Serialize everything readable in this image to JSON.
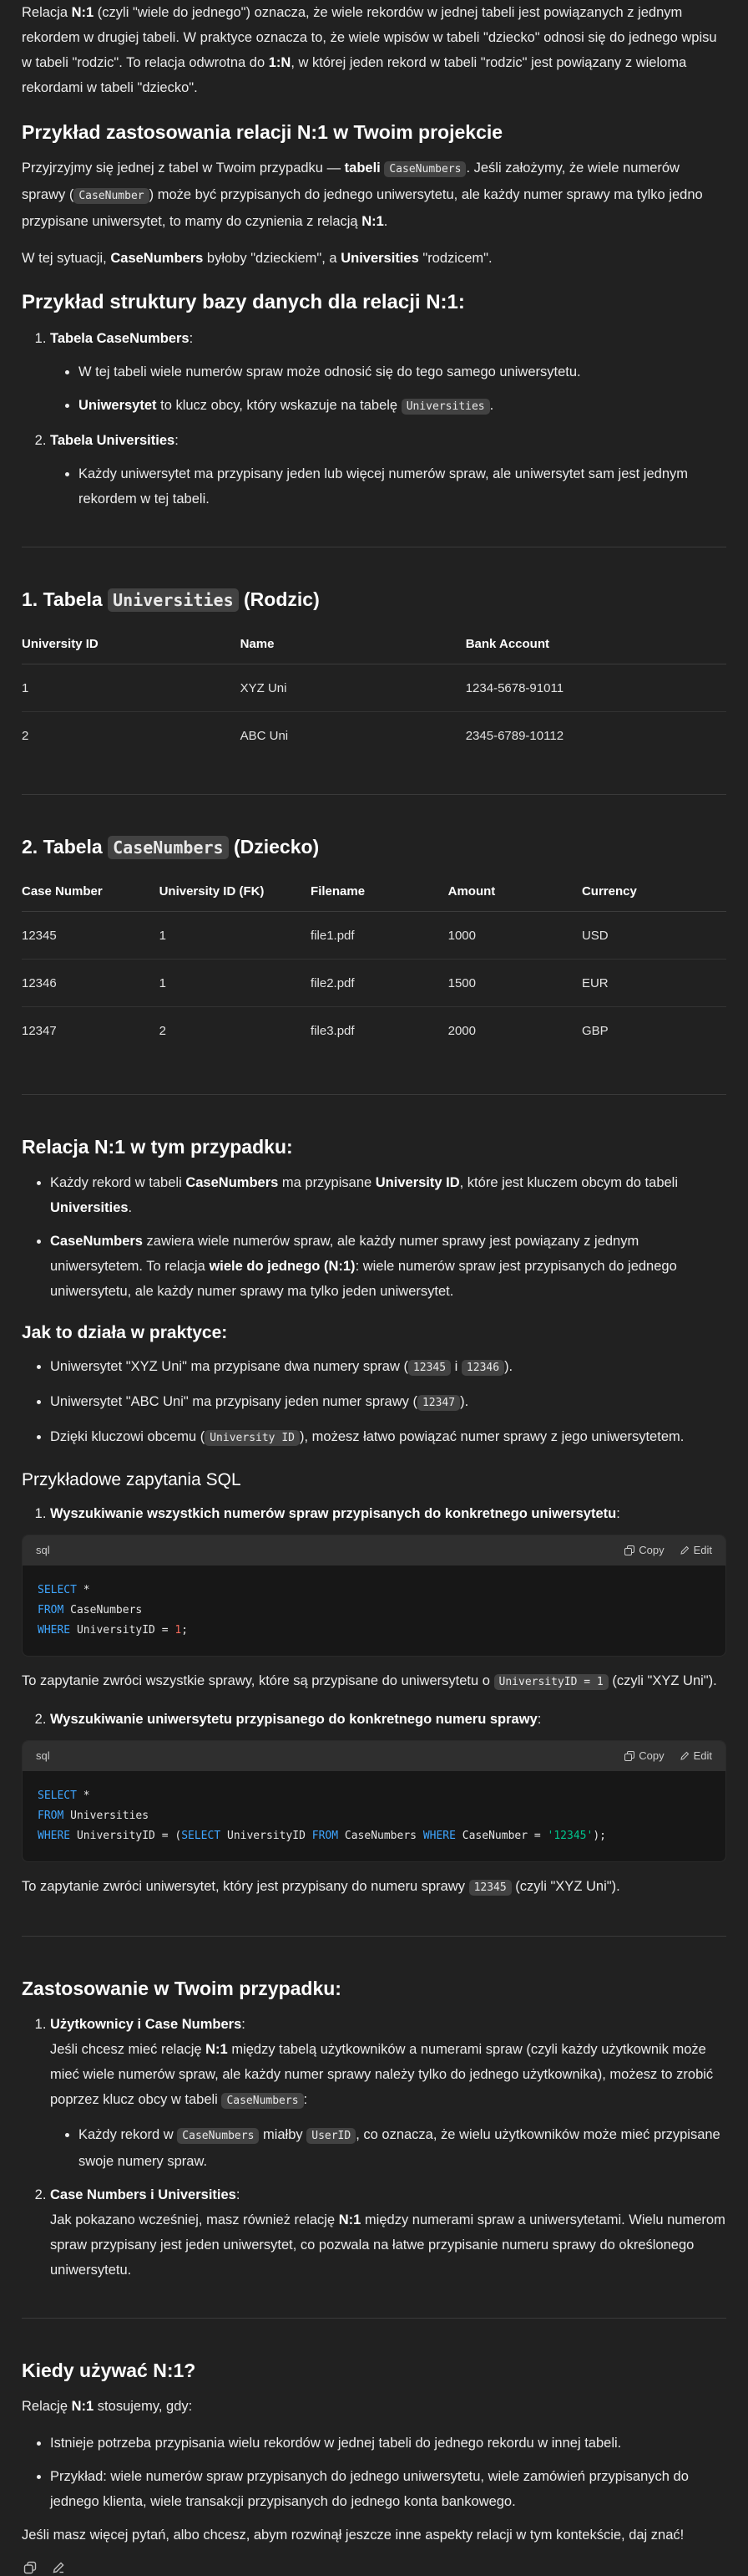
{
  "intro": {
    "p1_a": "Relacja ",
    "p1_b": "N:1",
    "p1_c": " (czyli \"wiele do jednego\") oznacza, że wiele rekordów w jednej tabeli jest powiązanych z jednym rekordem w drugiej tabeli. W praktyce oznacza to, że wiele wpisów w tabeli \"dziecko\" odnosi się do jednego wpisu w tabeli \"rodzic\". To relacja odwrotna do ",
    "p1_d": "1:N",
    "p1_e": ", w której jeden rekord w tabeli \"rodzic\" jest powiązany z wieloma rekordami w tabeli \"dziecko\"."
  },
  "example": {
    "heading": "Przykład zastosowania relacji N:1 w Twoim projekcie",
    "p1_a": "Przyjrzyjmy się jednej z tabel w Twoim przypadku — ",
    "p1_b": "tabeli",
    "p1_code": "CaseNumbers",
    "p1_c": ". Jeśli założymy, że wiele numerów sprawy (",
    "p1_code2": "CaseNumber",
    "p1_d": ") może być przypisanych do jednego uniwersytetu, ale każdy numer sprawy ma tylko jedno przypisane uniwersytet, to mamy do czynienia z relacją ",
    "p1_e": "N:1",
    "p1_f": ".",
    "p2_a": "W tej sytuacji, ",
    "p2_b": "CaseNumbers",
    "p2_c": " byłoby \"dzieckiem\", a ",
    "p2_d": "Universities",
    "p2_e": " \"rodzicem\"."
  },
  "structure": {
    "heading": "Przykład struktury bazy danych dla relacji N:1:",
    "item1_title": "Tabela CaseNumbers",
    "item1_colon": ":",
    "item1_b1": "W tej tabeli wiele numerów spraw może odnosić się do tego samego uniwersytetu.",
    "item1_b2_a": "Uniwersytet",
    "item1_b2_b": " to klucz obcy, który wskazuje na tabelę ",
    "item1_b2_code": "Universities",
    "item1_b2_c": ".",
    "item2_title": "Tabela Universities",
    "item2_colon": ":",
    "item2_b1": "Każdy uniwersytet ma przypisany jeden lub więcej numerów spraw, ale uniwersytet sam jest jednym rekordem w tej tabeli."
  },
  "table1": {
    "heading_a": "1. Tabela ",
    "heading_code": "Universities",
    "heading_b": " (Rodzic)",
    "headers": [
      "University ID",
      "Name",
      "Bank Account"
    ],
    "rows": [
      [
        "1",
        "XYZ Uni",
        "1234-5678-91011"
      ],
      [
        "2",
        "ABC Uni",
        "2345-6789-10112"
      ]
    ]
  },
  "table2": {
    "heading_a": "2. Tabela ",
    "heading_code": "CaseNumbers",
    "heading_b": " (Dziecko)",
    "headers": [
      "Case Number",
      "University ID (FK)",
      "Filename",
      "Amount",
      "Currency"
    ],
    "rows": [
      [
        "12345",
        "1",
        "file1.pdf",
        "1000",
        "USD"
      ],
      [
        "12346",
        "1",
        "file2.pdf",
        "1500",
        "EUR"
      ],
      [
        "12347",
        "2",
        "file3.pdf",
        "2000",
        "GBP"
      ]
    ]
  },
  "relation": {
    "heading": "Relacja N:1 w tym przypadku:",
    "b1_a": "Każdy rekord w tabeli ",
    "b1_b": "CaseNumbers",
    "b1_c": " ma przypisane ",
    "b1_d": "University ID",
    "b1_e": ", które jest kluczem obcym do tabeli ",
    "b1_f": "Universities",
    "b1_g": ".",
    "b2_a": "CaseNumbers",
    "b2_b": " zawiera wiele numerów spraw, ale każdy numer sprawy jest powiązany z jednym uniwersytetem. To relacja ",
    "b2_c": "wiele do jednego (N:1)",
    "b2_d": ": wiele numerów spraw jest przypisanych do jednego uniwersytetu, ale każdy numer sprawy ma tylko jeden uniwersytet."
  },
  "practice": {
    "heading": "Jak to działa w praktyce:",
    "b1_a": "Uniwersytet \"XYZ Uni\" ma przypisane dwa numery spraw (",
    "b1_code1": "12345",
    "b1_b": " i ",
    "b1_code2": "12346",
    "b1_c": ").",
    "b2_a": "Uniwersytet \"ABC Uni\" ma przypisany jeden numer sprawy (",
    "b2_code": "12347",
    "b2_b": ").",
    "b3_a": "Dzięki kluczowi obcemu (",
    "b3_code": "University ID",
    "b3_b": "), możesz łatwo powiązać numer sprawy z jego uniwersytetem."
  },
  "sql": {
    "heading": "Przykładowe zapytania SQL",
    "q1_title": "Wyszukiwanie wszystkich numerów spraw przypisanych do konkretnego uniwersytetu",
    "q1_colon": ":",
    "lang": "sql",
    "copy": "Copy",
    "edit": "Edit",
    "q1_after_a": "To zapytanie zwróci wszystkie sprawy, które są przypisane do uniwersytetu o ",
    "q1_after_code": "UniversityID = 1",
    "q1_after_b": " (czyli \"XYZ Uni\").",
    "q2_title": "Wyszukiwanie uniwersytetu przypisanego do konkretnego numeru sprawy",
    "q2_colon": ":",
    "q2_after_a": "To zapytanie zwróci uniwersytet, który jest przypisany do numeru sprawy ",
    "q2_after_code": "12345",
    "q2_after_b": " (czyli \"XYZ Uni\")."
  },
  "usage": {
    "heading": "Zastosowanie w Twoim przypadku:",
    "i1_title": "Użytkownicy i Case Numbers",
    "i1_colon": ":",
    "i1_a": "Jeśli chcesz mieć relację ",
    "i1_b": "N:1",
    "i1_c": " między tabelą użytkowników a numerami spraw (czyli każdy użytkownik może mieć wiele numerów spraw, ale każdy numer sprawy należy tylko do jednego użytkownika), możesz to zrobić poprzez klucz obcy w tabeli ",
    "i1_code": "CaseNumbers",
    "i1_d": ":",
    "i1_b1_a": "Każdy rekord w ",
    "i1_b1_code1": "CaseNumbers",
    "i1_b1_b": " miałby ",
    "i1_b1_code2": "UserID",
    "i1_b1_c": ", co oznacza, że wielu użytkowników może mieć przypisane swoje numery spraw.",
    "i2_title": "Case Numbers i Universities",
    "i2_colon": ":",
    "i2_a": "Jak pokazano wcześniej, masz również relację ",
    "i2_b": "N:1",
    "i2_c": " między numerami spraw a uniwersytetami. Wielu numerom spraw przypisany jest jeden uniwersytet, co pozwala na łatwe przypisanie numeru sprawy do określonego uniwersytetu."
  },
  "when": {
    "heading": "Kiedy używać N:1?",
    "p_a": "Relację ",
    "p_b": "N:1",
    "p_c": " stosujemy, gdy:",
    "b1": "Istnieje potrzeba przypisania wielu rekordów w jednej tabeli do jednego rekordu w innej tabeli.",
    "b2": "Przykład: wiele numerów spraw przypisanych do jednego uniwersytetu, wiele zamówień przypisanych do jednego klienta, wiele transakcji przypisanych do jednego konta bankowego.",
    "closing": "Jeśli masz więcej pytań, albo chcesz, abym rozwinął jeszcze inne aspekty relacji w tym kontekście, daj znać!"
  },
  "footer": {
    "copy_icon": "copy-icon",
    "edit_icon": "edit-icon"
  }
}
